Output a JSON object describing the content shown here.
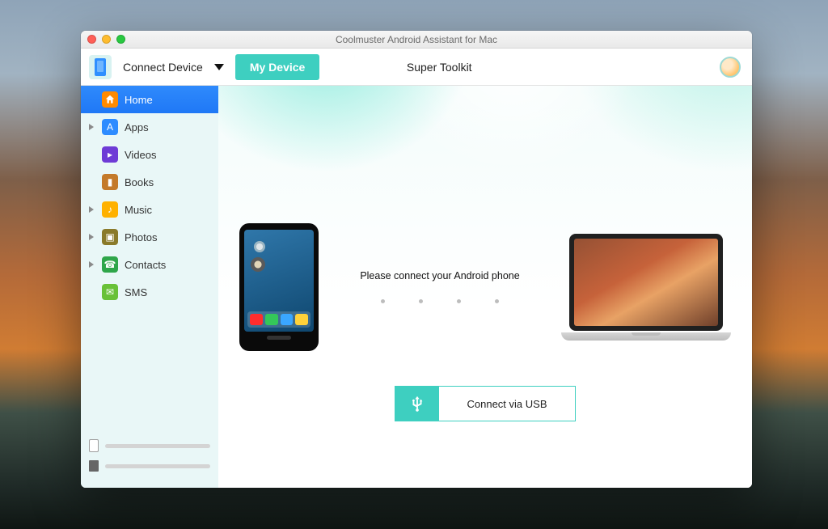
{
  "window": {
    "title": "Coolmuster Android Assistant for Mac"
  },
  "toolbar": {
    "connect_label": "Connect Device",
    "my_device_label": "My Device",
    "super_toolkit_label": "Super Toolkit"
  },
  "sidebar": {
    "items": [
      {
        "label": "Home",
        "icon": "home",
        "expandable": false,
        "active": true
      },
      {
        "label": "Apps",
        "icon": "apps",
        "expandable": true,
        "active": false
      },
      {
        "label": "Videos",
        "icon": "videos",
        "expandable": false,
        "active": false
      },
      {
        "label": "Books",
        "icon": "books",
        "expandable": false,
        "active": false
      },
      {
        "label": "Music",
        "icon": "music",
        "expandable": true,
        "active": false
      },
      {
        "label": "Photos",
        "icon": "photos",
        "expandable": true,
        "active": false
      },
      {
        "label": "Contacts",
        "icon": "contacts",
        "expandable": true,
        "active": false
      },
      {
        "label": "SMS",
        "icon": "sms",
        "expandable": false,
        "active": false
      }
    ]
  },
  "main": {
    "prompt": "Please connect your Android phone",
    "connect_button": "Connect via USB"
  },
  "colors": {
    "accent": "#3ecfc0",
    "active_blue": "#2a84fb"
  }
}
